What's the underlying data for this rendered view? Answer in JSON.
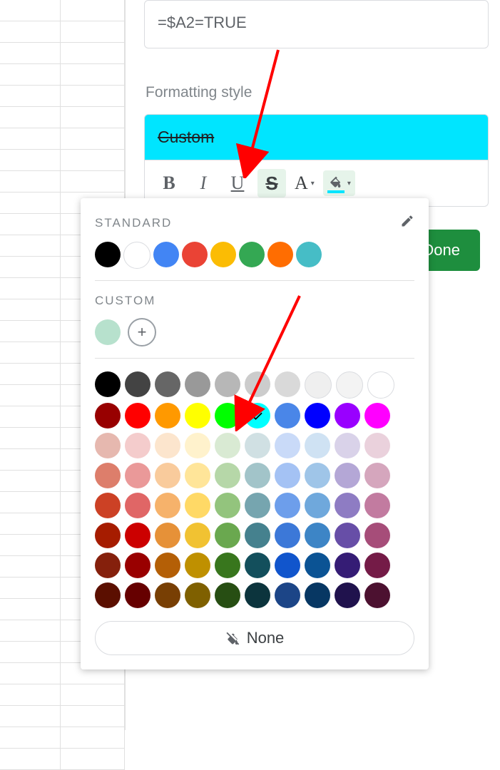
{
  "formula": "=$A2=TRUE",
  "section_label": "Formatting style",
  "preview_text": "Custom",
  "toolbar": {
    "bold": "B",
    "italic": "I",
    "underline": "U",
    "strike": "S",
    "textcolor": "A"
  },
  "done_label": "Done",
  "picker": {
    "standard_title": "STANDARD",
    "custom_title": "CUSTOM",
    "none_label": "None",
    "standard_colors": [
      "#000000",
      "#ffffff",
      "#4285f4",
      "#ea4335",
      "#fbbc04",
      "#34a853",
      "#ff6d01",
      "#46bdc6"
    ],
    "custom_colors": [
      "#b7e1cd"
    ],
    "selected_color": "#00ffff",
    "palette": [
      [
        "#000000",
        "#434343",
        "#666666",
        "#999999",
        "#b7b7b7",
        "#cccccc",
        "#d9d9d9",
        "#efefef",
        "#f3f3f3",
        "#ffffff"
      ],
      [
        "#980000",
        "#ff0000",
        "#ff9900",
        "#ffff00",
        "#00ff00",
        "#00ffff",
        "#4a86e8",
        "#0000ff",
        "#9900ff",
        "#ff00ff"
      ],
      [
        "#e6b8af",
        "#f4cccc",
        "#fce5cd",
        "#fff2cc",
        "#d9ead3",
        "#d0e0e3",
        "#c9daf8",
        "#cfe2f3",
        "#d9d2e9",
        "#ead1dc"
      ],
      [
        "#dd7e6b",
        "#ea9999",
        "#f9cb9c",
        "#ffe599",
        "#b6d7a8",
        "#a2c4c9",
        "#a4c2f4",
        "#9fc5e8",
        "#b4a7d6",
        "#d5a6bd"
      ],
      [
        "#cc4125",
        "#e06666",
        "#f6b26b",
        "#ffd966",
        "#93c47d",
        "#76a5af",
        "#6d9eeb",
        "#6fa8dc",
        "#8e7cc3",
        "#c27ba0"
      ],
      [
        "#a61c00",
        "#cc0000",
        "#e69138",
        "#f1c232",
        "#6aa84f",
        "#45818e",
        "#3c78d8",
        "#3d85c6",
        "#674ea7",
        "#a64d79"
      ],
      [
        "#85200c",
        "#990000",
        "#b45f06",
        "#bf9000",
        "#38761d",
        "#134f5c",
        "#1155cc",
        "#0b5394",
        "#351c75",
        "#741b47"
      ],
      [
        "#5b0f00",
        "#660000",
        "#783f04",
        "#7f6000",
        "#274e13",
        "#0c343d",
        "#1c4587",
        "#073763",
        "#20124d",
        "#4c1130"
      ]
    ]
  }
}
